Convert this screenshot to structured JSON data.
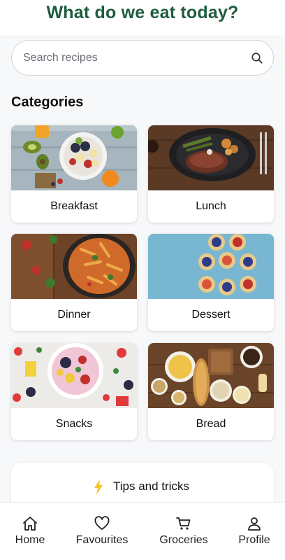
{
  "header": {
    "title": "What do we eat today?"
  },
  "search": {
    "placeholder": "Search recipes",
    "icon": "search-icon"
  },
  "categories": {
    "title": "Categories",
    "items": [
      {
        "label": "Breakfast"
      },
      {
        "label": "Lunch"
      },
      {
        "label": "Dinner"
      },
      {
        "label": "Dessert"
      },
      {
        "label": "Snacks"
      },
      {
        "label": "Bread"
      }
    ]
  },
  "tips": {
    "label": "Tips and tricks",
    "icon": "lightning-icon"
  },
  "nav": {
    "items": [
      {
        "label": "Home",
        "icon": "home-icon"
      },
      {
        "label": "Favourites",
        "icon": "heart-icon"
      },
      {
        "label": "Groceries",
        "icon": "cart-icon"
      },
      {
        "label": "Profile",
        "icon": "person-icon"
      }
    ]
  },
  "colors": {
    "title": "#1d5c3d",
    "accent": "#f2c230",
    "background": "#f7f8fa"
  }
}
